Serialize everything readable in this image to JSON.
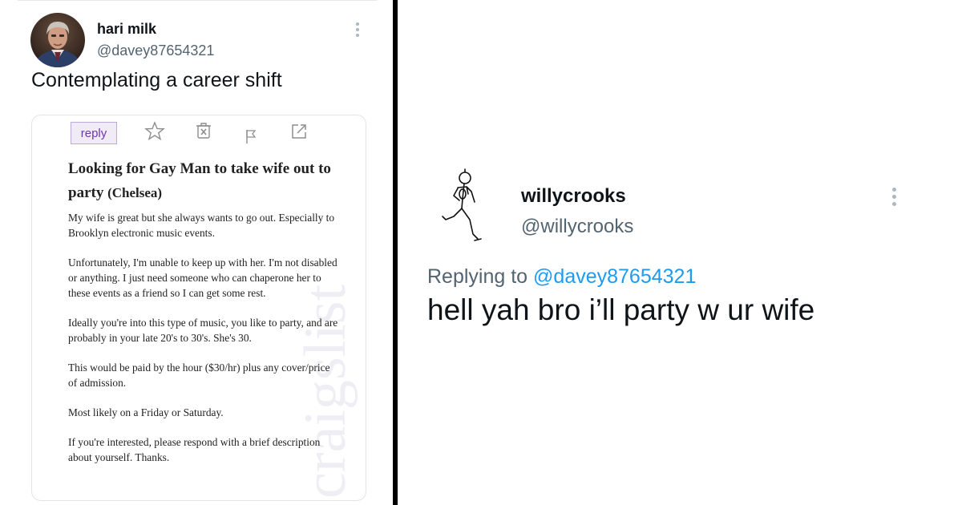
{
  "tweet1": {
    "name": "hari milk",
    "handle": "@davey87654321",
    "text": "Contemplating a career shift",
    "avatar_icon": "user-avatar-photo",
    "more_icon": "more-vertical-icon"
  },
  "craigslist": {
    "reply_label": "reply",
    "watermark": "craigslist",
    "icons": [
      "star-icon",
      "trash-icon",
      "flag-icon",
      "share-icon"
    ],
    "title": "Looking for Gay Man to take wife out to party",
    "location": "(Chelsea)",
    "paragraphs": [
      "My wife is great but she always wants to go out. Especially to Brooklyn electronic music events.",
      "Unfortunately, I'm unable to keep up with her. I'm not disabled or anything. I just need someone who can chaperone her to these events as a friend so I can get some rest.",
      "Ideally you're into this type of music, you like to party, and are probably in your late 20's to 30's. She's 30.",
      "This would be paid by the hour ($30/hr) plus any cover/price of admission.",
      "Most likely on a Friday or Saturday.",
      "If you're interested, please respond with a brief description about yourself. Thanks."
    ]
  },
  "tweet2": {
    "name": "willycrooks",
    "handle": "@willycrooks",
    "replying_prefix": "Replying to",
    "replying_to": "@davey87654321",
    "text": "hell yah bro i’ll party w ur wife",
    "avatar_icon": "running-stick-figure-avatar",
    "more_icon": "more-vertical-icon"
  },
  "colors": {
    "text": "#0f1419",
    "secondary": "#536471",
    "link": "#1d9bf0",
    "divider": "#000000",
    "reply_button_bg": "#f1ebf8",
    "reply_button_text": "#6c3aa8"
  }
}
